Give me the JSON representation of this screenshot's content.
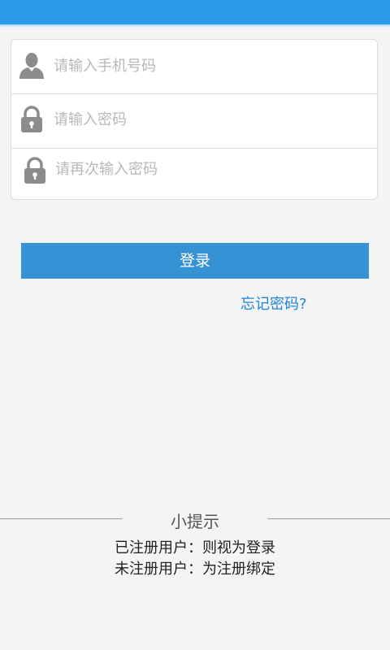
{
  "status_bar": {
    "color": "#2a9be6"
  },
  "form": {
    "phone": {
      "placeholder": "请输入手机号码",
      "value": "",
      "icon": "user-icon"
    },
    "password": {
      "placeholder": "请输入密码",
      "value": "",
      "icon": "lock-icon"
    },
    "confirm_password": {
      "placeholder": "请再次输入密码",
      "value": "",
      "icon": "lock-icon"
    }
  },
  "login_button": {
    "label": "登录",
    "color": "#3592d4"
  },
  "forgot_link": {
    "label": "忘记密码?",
    "color": "#1f84d8"
  },
  "tips": {
    "title": "小提示",
    "lines": [
      "已注册用户：则视为登录",
      "未注册用户：为注册绑定"
    ]
  }
}
